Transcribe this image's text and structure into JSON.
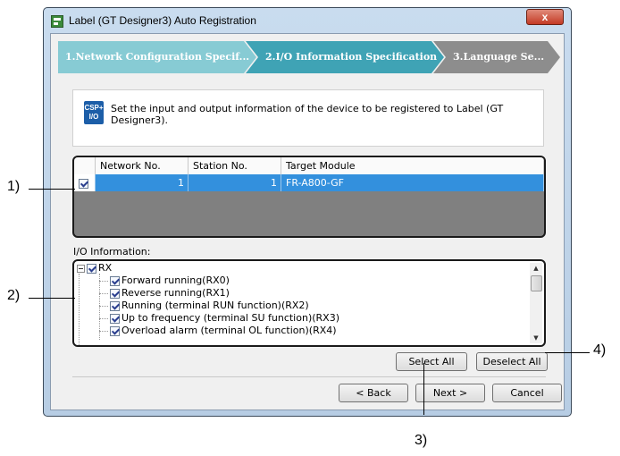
{
  "window": {
    "title": "Label (GT Designer3) Auto Registration",
    "close_glyph": "x"
  },
  "steps": [
    {
      "label": "1.Network Configuration Specif..."
    },
    {
      "label": "2.I/O Information Specification"
    },
    {
      "label": "3.Language Se..."
    }
  ],
  "description": {
    "icon_text_top": "CSP+",
    "icon_text_bottom": "I/O",
    "text": "Set the input and output information of the device to be registered to Label (GT Designer3)."
  },
  "grid": {
    "columns": [
      "Network No.",
      "Station No.",
      "Target Module"
    ],
    "rows": [
      {
        "checked": true,
        "network_no": "1",
        "station_no": "1",
        "target_module": "FR-A800-GF"
      }
    ]
  },
  "io_info": {
    "label": "I/O Information:",
    "root": "RX",
    "items": [
      "Forward running(RX0)",
      "Reverse running(RX1)",
      "Running (terminal RUN function)(RX2)",
      "Up to frequency (terminal SU function)(RX3)",
      "Overload alarm (terminal OL function)(RX4)"
    ]
  },
  "buttons": {
    "select_all": "Select All",
    "deselect_all": "Deselect All",
    "back": "< Back",
    "next": "Next >",
    "cancel": "Cancel"
  },
  "callouts": {
    "c1": "1)",
    "c2": "2)",
    "c3": "3)",
    "c4": "4)"
  }
}
